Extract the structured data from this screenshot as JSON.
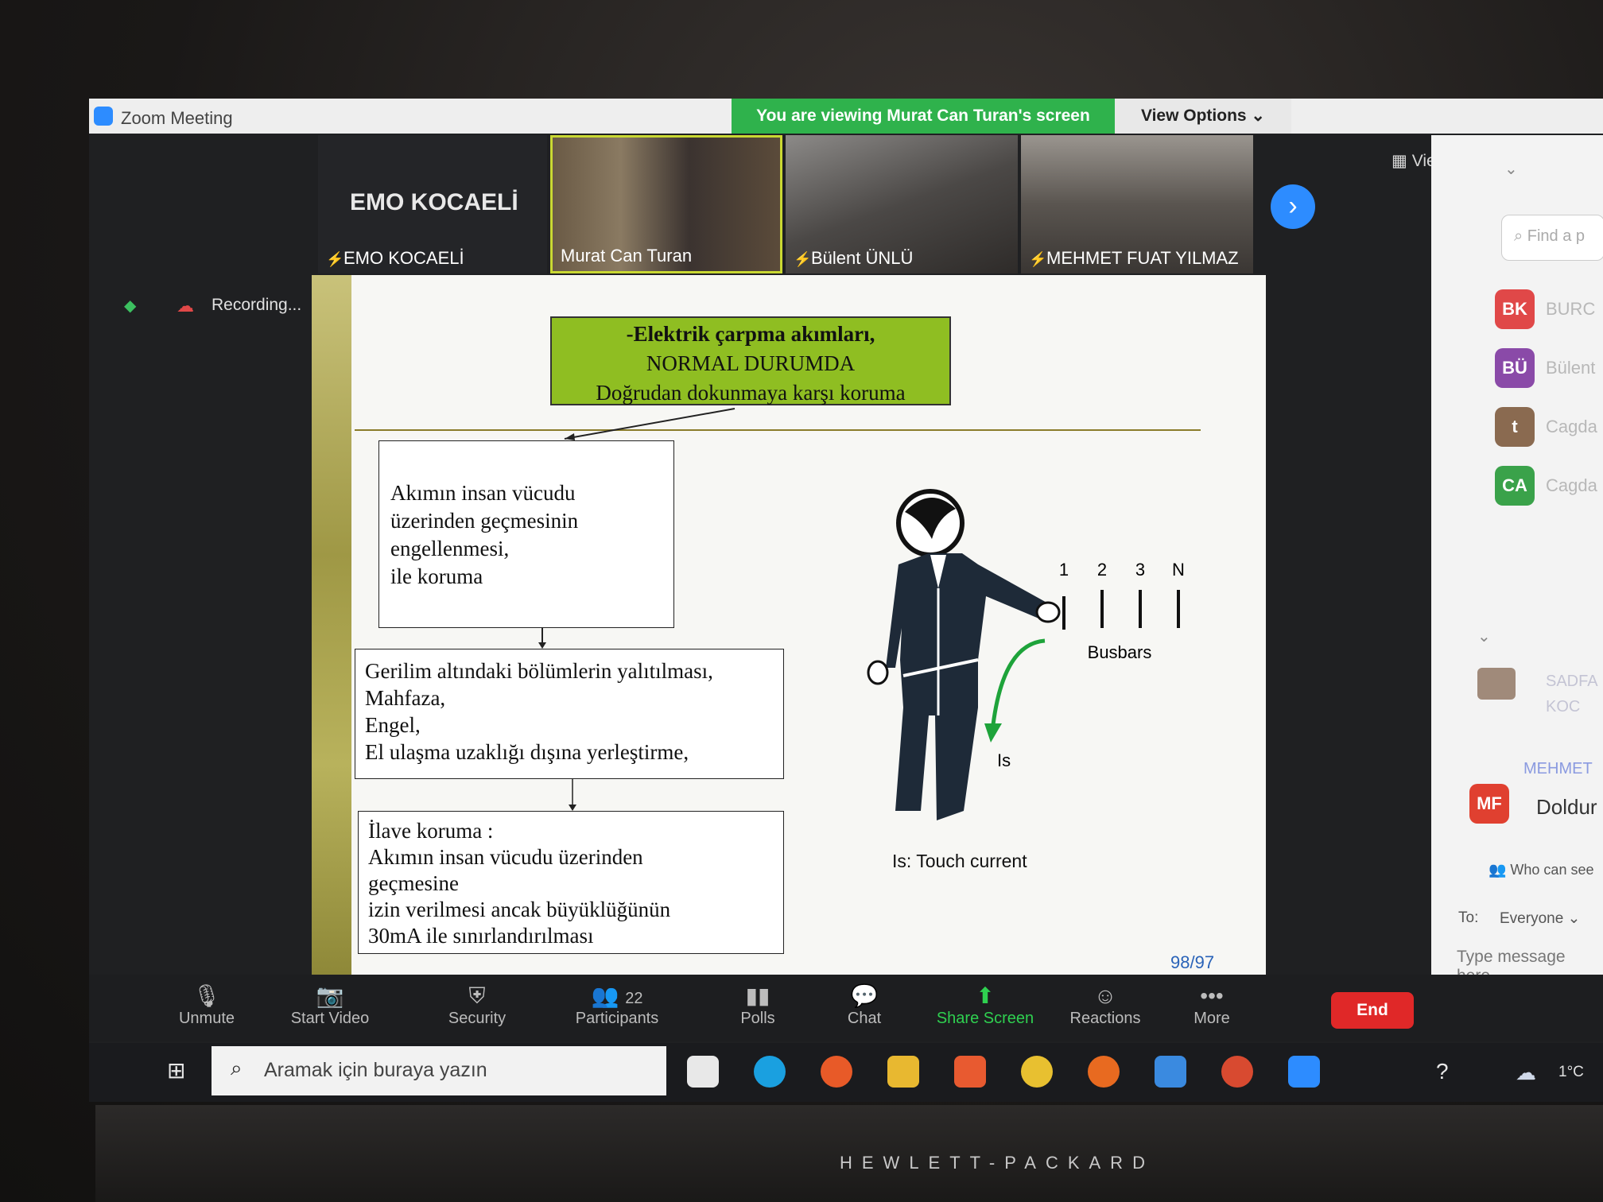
{
  "window": {
    "title": "Zoom Meeting"
  },
  "banner": {
    "viewing": "You are viewing Murat Can Turan's screen",
    "view_options": "View Options ⌄"
  },
  "videos": [
    {
      "name": "EMO KOCAELİ",
      "big_label": "EMO KOCAELİ",
      "muted": true
    },
    {
      "name": "Murat Can Turan",
      "muted": false
    },
    {
      "name": "Bülent ÜNLÜ",
      "muted": true
    },
    {
      "name": "MEHMET FUAT YILMAZ",
      "muted": true
    }
  ],
  "view_button": "View",
  "recording": {
    "label": "Recording..."
  },
  "slide": {
    "title_lines": [
      "-Elektrik çarpma akımları,",
      "NORMAL DURUMDA",
      "Doğrudan dokunmaya karşı koruma"
    ],
    "box1": [
      "Akımın insan vücudu",
      "üzerinden geçmesinin",
      "engellenmesi,",
      "ile koruma"
    ],
    "box2": [
      "Gerilim altındaki bölümlerin yalıtılması,",
      "Mahfaza,",
      "Engel,",
      "El ulaşma uzaklığı dışına yerleştirme,"
    ],
    "box3": [
      "İlave koruma :",
      "Akımın insan vücudu üzerinden",
      "geçmesine",
      "izin verilmesi ancak büyüklüğünün",
      "30mA ile sınırlandırılması"
    ],
    "busbar_numbers": [
      "1",
      "2",
      "3",
      "N"
    ],
    "busbars_label": "Busbars",
    "is_label": "Is",
    "caption": "Is: Touch current",
    "page": "98/97"
  },
  "participants_panel": {
    "find_placeholder": "Find a p",
    "people": [
      {
        "initials": "BK",
        "name": "BURC",
        "color": "#e04848"
      },
      {
        "initials": "BÜ",
        "name": "Bülent",
        "color": "#8a4aa8"
      },
      {
        "initials": "t",
        "name": "Cagda",
        "color": "#8a6a50"
      },
      {
        "initials": "CA",
        "name": "Cagda",
        "color": "#3aa24a"
      }
    ],
    "partial_names": [
      "MEHMET",
      "SADFA",
      "KOC"
    ],
    "mf_initials": "MF",
    "mf_text": "Doldur",
    "who_can_see": "Who can see",
    "to_label": "To:",
    "to_value": "Everyone",
    "message_placeholder": "Type message here"
  },
  "toolbar": {
    "unmute": "Unmute",
    "start_video": "Start Video",
    "security": "Security",
    "participants": "Participants",
    "participants_count": "22",
    "polls": "Polls",
    "chat": "Chat",
    "share_screen": "Share Screen",
    "reactions": "Reactions",
    "more": "More",
    "end": "End"
  },
  "taskbar": {
    "search_placeholder": "Aramak için buraya yazın",
    "temperature": "1°C"
  },
  "brand": "HEWLETT-PACKARD"
}
